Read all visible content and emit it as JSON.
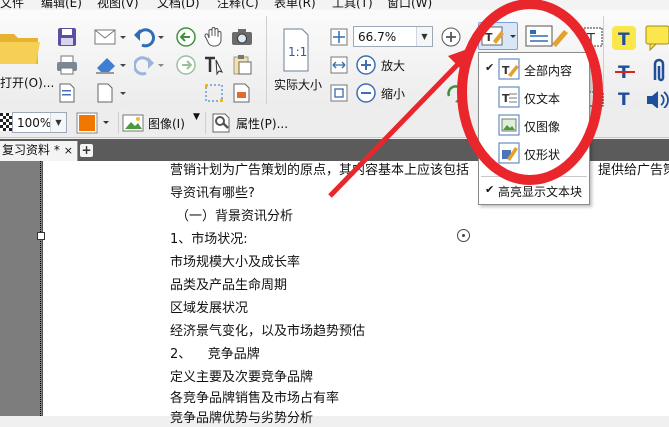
{
  "menubar": {
    "items": [
      "文件",
      "编辑(E)",
      "视图(V)",
      "文档(D)",
      "注释(C)",
      "表单(R)",
      "工具(T)",
      "窗口(W)"
    ]
  },
  "ribbon": {
    "open_label": "打开(O)...",
    "zoom_value": "66.7%",
    "actual_size_label": "实际大小",
    "zoom_in_label": "放大",
    "zoom_out_label": "缩小",
    "opacity_value": "100%",
    "image_label": "图像(I)",
    "properties_label": "属性(P)...",
    "fill_color": "#f07800"
  },
  "tab": {
    "title": "复习资料 *",
    "close_glyph": "×",
    "new_tab_glyph": "+"
  },
  "dropdown": {
    "items": [
      {
        "label": "全部内容",
        "checked": true
      },
      {
        "label": "仅文本",
        "checked": false
      },
      {
        "label": "仅图像",
        "checked": false
      },
      {
        "label": "仅形状",
        "checked": false
      }
    ],
    "highlight_label": "高亮显示文本块",
    "highlight_checked": true,
    "check_glyph": "✔"
  },
  "document": {
    "lines": [
      "营销计划为广告策划的原点，其内容基本上应该包括",
      "导资讯有哪些?",
      "（一）背景资讯分析",
      "1、市场状况:",
      "市场规模大小及成长率",
      "品类及产品生命周期",
      "区域发展状况",
      "经济景气变化，以及市场趋势预估",
      "2、    竞争品牌",
      "定义主要及次要竞争品牌",
      "各竞争品牌销售及市场占有率",
      "竞争品牌优势与劣势分析"
    ],
    "right_fragment": "提供给广告策"
  },
  "colors": {
    "annotation_red": "#e8262b",
    "accent_blue": "#2e6db4",
    "tab_strip": "#5b5b5b"
  }
}
